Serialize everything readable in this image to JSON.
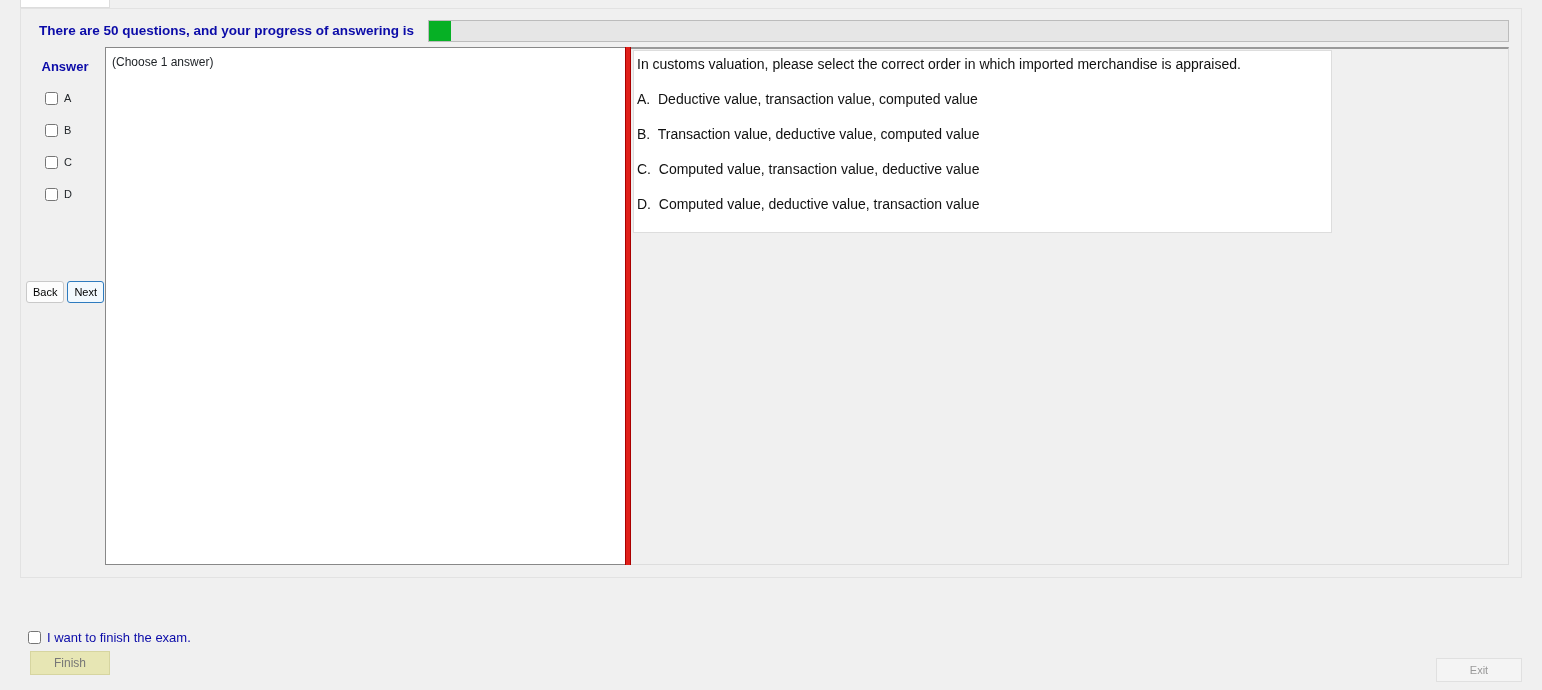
{
  "progress": {
    "text": "There are 50 questions, and your progress of answering is",
    "level": 0.02
  },
  "answer": {
    "label": "Answer",
    "options": [
      {
        "letter": "A",
        "checked": false
      },
      {
        "letter": "B",
        "checked": false
      },
      {
        "letter": "C",
        "checked": false
      },
      {
        "letter": "D",
        "checked": false
      }
    ]
  },
  "nav_buttons": [
    {
      "label": "Back",
      "selected": false
    },
    {
      "label": "Next",
      "selected": true
    }
  ],
  "answer_hint": "(Choose 1 answer)",
  "question": {
    "text": "In customs valuation, please select the correct order in which imported merchandise is appraised.",
    "choices": [
      "A.  Deductive value, transaction value, computed value",
      "B.  Transaction value, deductive value, computed value",
      "C.  Computed value, transaction value, deductive value",
      "D.  Computed value, deductive value, transaction value"
    ]
  },
  "finish": {
    "label": "I want to finish the exam.",
    "checked": false,
    "button": "Finish",
    "button_disabled": true
  },
  "exit": {
    "label": "Exit",
    "disabled": true
  }
}
